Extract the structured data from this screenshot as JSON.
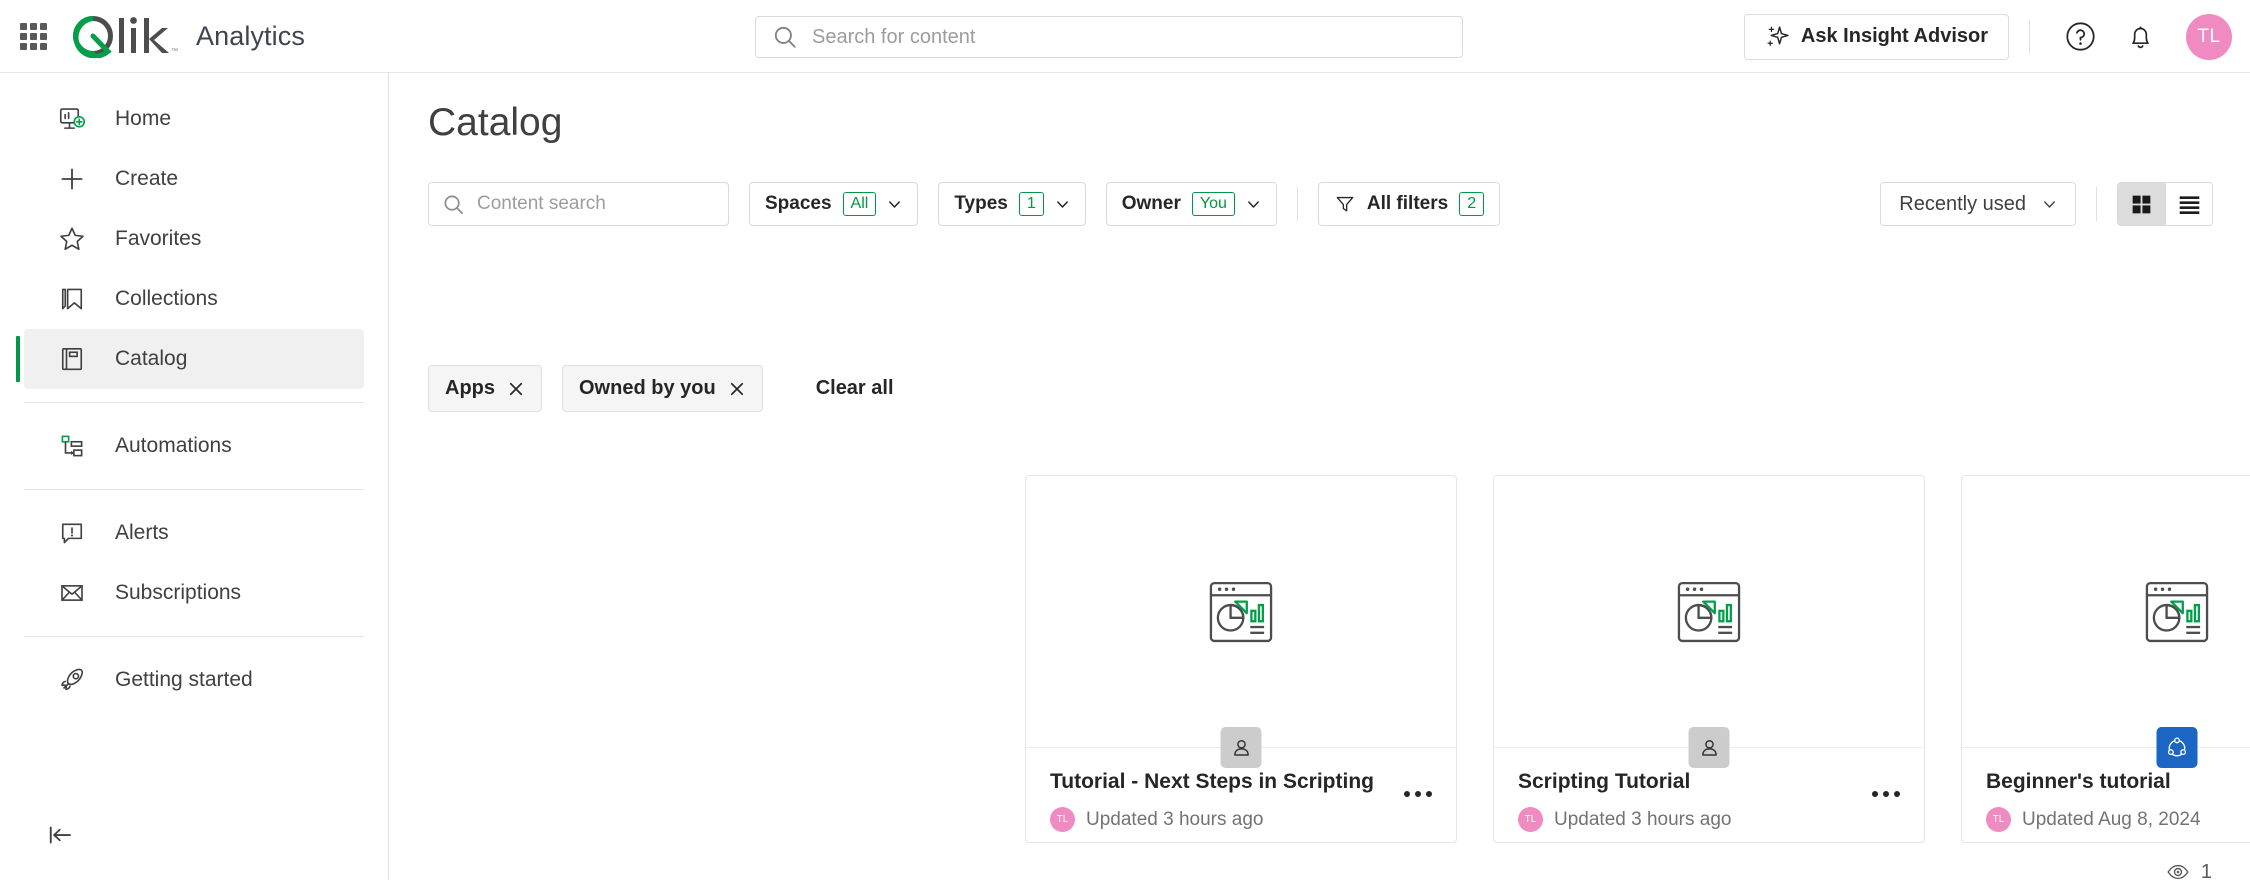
{
  "topbar": {
    "app_switcher": "app-switcher",
    "brand": "Qlik",
    "product": "Analytics",
    "search_placeholder": "Search for content",
    "insight_advisor": "Ask Insight Advisor",
    "help": "?",
    "avatar_initials": "TL",
    "avatar_color": "#ef8bc0"
  },
  "sidebar": {
    "items": [
      {
        "id": "home",
        "label": "Home",
        "icon": "home-dashboard-icon",
        "active": false
      },
      {
        "id": "create",
        "label": "Create",
        "icon": "plus-icon",
        "active": false
      },
      {
        "id": "favorites",
        "label": "Favorites",
        "icon": "star-outline-icon",
        "active": false
      },
      {
        "id": "collections",
        "label": "Collections",
        "icon": "bookmark-icon",
        "active": false
      },
      {
        "id": "catalog",
        "label": "Catalog",
        "icon": "catalog-book-icon",
        "active": true
      },
      {
        "id": "automations",
        "label": "Automations",
        "icon": "automations-flow-icon",
        "active": false
      },
      {
        "id": "alerts",
        "label": "Alerts",
        "icon": "alert-bubble-icon",
        "active": false
      },
      {
        "id": "subscriptions",
        "label": "Subscriptions",
        "icon": "envelope-icon",
        "active": false
      },
      {
        "id": "getting-started",
        "label": "Getting started",
        "icon": "rocket-icon",
        "active": false
      }
    ],
    "collapse": "collapse-sidebar-icon",
    "active_accent": "#009845"
  },
  "main": {
    "page_title": "Catalog",
    "toolbar": {
      "content_search_placeholder": "Content search",
      "spaces": {
        "label": "Spaces",
        "badge": "All"
      },
      "types": {
        "label": "Types",
        "badge": "1"
      },
      "owner": {
        "label": "Owner",
        "badge": "You"
      },
      "all_filters": {
        "label": "All filters",
        "badge": "2"
      },
      "sort": "Recently used",
      "view_grid": "grid-view-icon",
      "view_list": "list-view-icon",
      "view_selected": "grid"
    },
    "chips": [
      {
        "label": "Apps"
      },
      {
        "label": "Owned by you"
      }
    ],
    "clear_all": "Clear all",
    "cards": [
      {
        "title": "Tutorial - Next Steps in Scripting",
        "date": "Updated 3 hours ago",
        "owner_initials": "TL",
        "space": "personal",
        "favorite": false
      },
      {
        "title": "Scripting Tutorial",
        "date": "Updated 3 hours ago",
        "owner_initials": "TL",
        "space": "personal",
        "favorite": false
      },
      {
        "title": "Beginner's tutorial",
        "date": "Updated Aug 8, 2024",
        "owner_initials": "TL",
        "space": "shared",
        "favorite": true
      }
    ],
    "result_count": "1"
  },
  "colors": {
    "qlik_green": "#009845",
    "shared_space_blue": "#1a66c2",
    "favorite_star_blue": "#1a66c2",
    "personal_space_gray": "#cccccc"
  }
}
